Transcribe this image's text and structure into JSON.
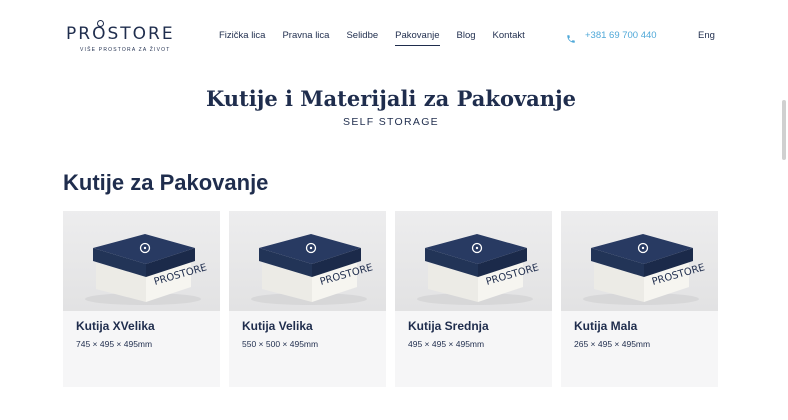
{
  "header": {
    "logo": {
      "word_pre": "PR",
      "word_o": "O",
      "word_post": "STORE",
      "tagline": "VIŠE PROSTORA ZA ŽIVOT"
    },
    "nav": [
      {
        "label": "Fizička lica",
        "active": false
      },
      {
        "label": "Pravna lica",
        "active": false
      },
      {
        "label": "Selidbe",
        "active": false
      },
      {
        "label": "Pakovanje",
        "active": true
      },
      {
        "label": "Blog",
        "active": false
      },
      {
        "label": "Kontakt",
        "active": false
      }
    ],
    "phone": {
      "icon": "phone-icon",
      "number": "+381 69 700 440"
    },
    "language": "Eng"
  },
  "hero": {
    "title": "Kutije i Materijali za Pakovanje",
    "subtitle": "SELF STORAGE"
  },
  "section": {
    "title": "Kutije za Pakovanje",
    "products": [
      {
        "name": "Kutija XVelika",
        "dimensions": "745 × 495 × 495mm",
        "box_label": "PROSTORE"
      },
      {
        "name": "Kutija Velika",
        "dimensions": "550 × 500 × 495mm",
        "box_label": "PROSTORE"
      },
      {
        "name": "Kutija Srednja",
        "dimensions": "495 × 495 × 495mm",
        "box_label": "PROSTORE"
      },
      {
        "name": "Kutija Mala",
        "dimensions": "265 × 495 × 495mm",
        "box_label": "PROSTORE"
      }
    ]
  },
  "colors": {
    "navy": "#1f2d4d",
    "phone_blue": "#4fa8d8",
    "card_bg": "#f6f6f7"
  }
}
